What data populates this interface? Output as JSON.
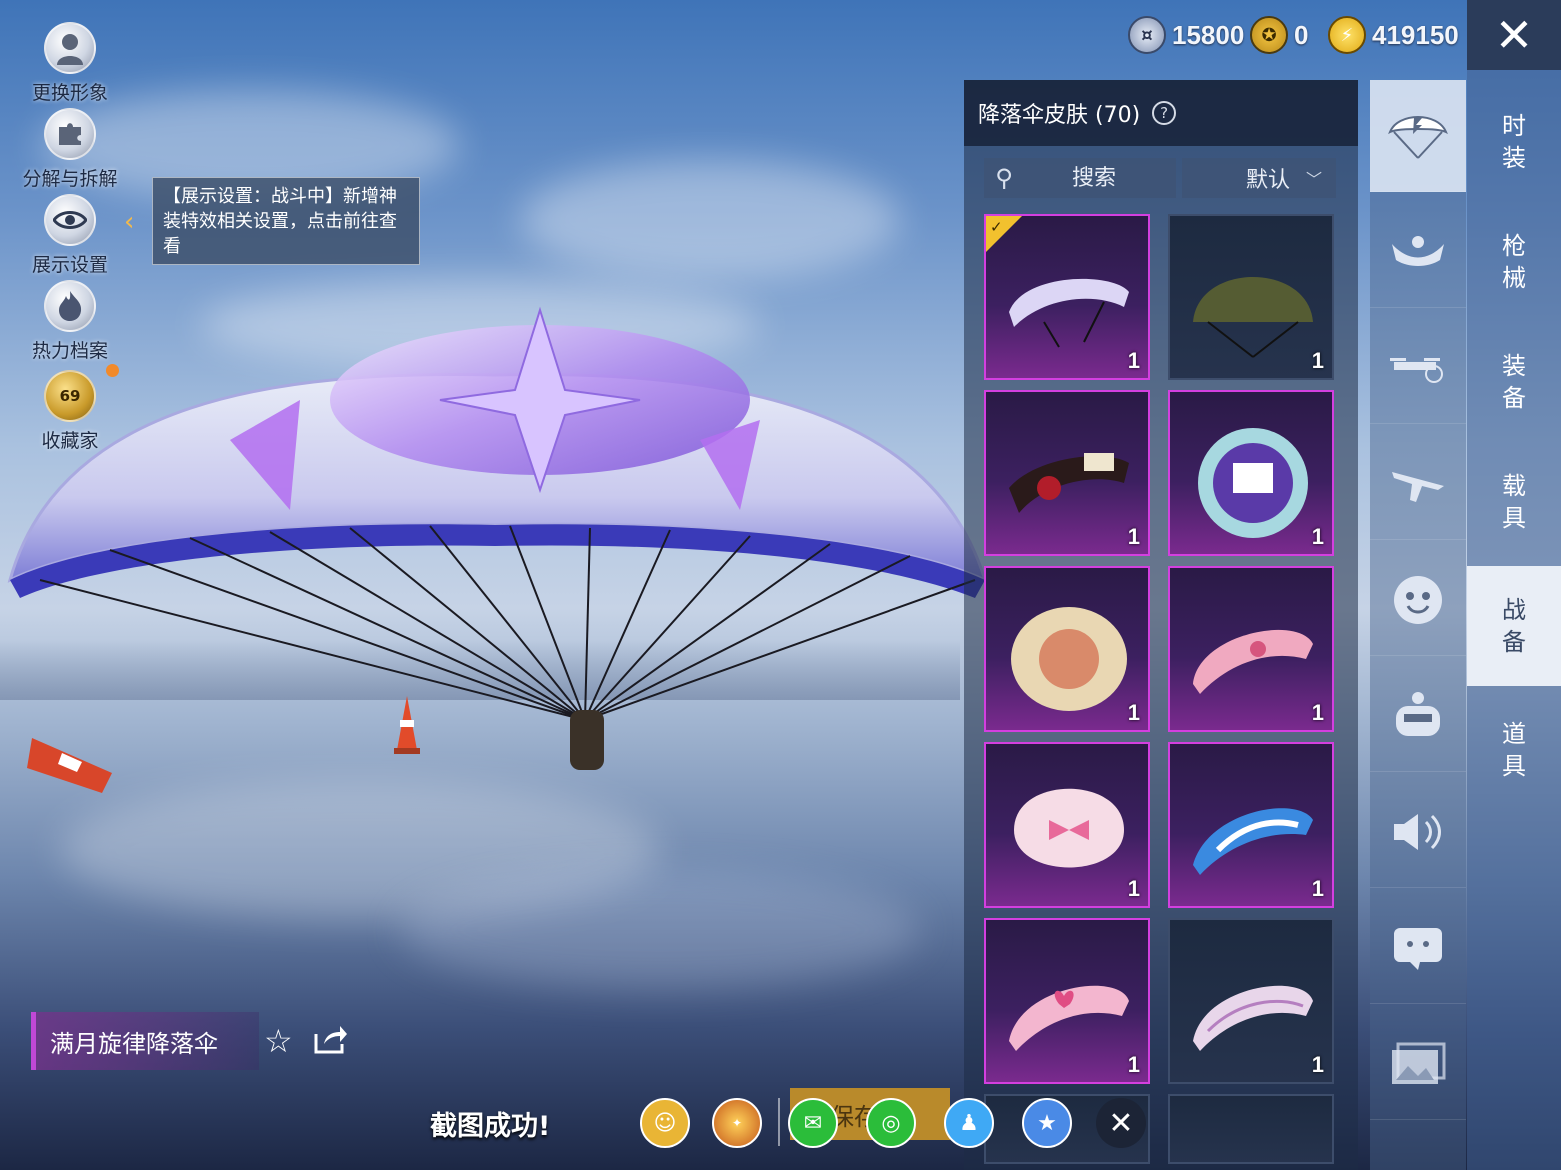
{
  "left_tools": [
    {
      "label": "更换形象",
      "icon": "avatar-icon"
    },
    {
      "label": "分解与拆解",
      "icon": "puzzle-icon"
    },
    {
      "label": "展示设置",
      "icon": "eye-icon"
    },
    {
      "label": "热力档案",
      "icon": "flame-icon"
    },
    {
      "label": "收藏家",
      "icon": "collector-badge-icon",
      "level": "69"
    }
  ],
  "tooltip": {
    "text": "【展示设置：战斗中】新增神装特效相关设置，点击前往查看"
  },
  "currencies": [
    {
      "icon": "coin-icon",
      "value": "15800"
    },
    {
      "icon": "medal-icon",
      "value": "0"
    },
    {
      "icon": "energy-icon",
      "value": "419150"
    }
  ],
  "panel": {
    "title": "降落伞皮肤 (70)",
    "search_placeholder": "搜索",
    "sort_value": "默认",
    "items": [
      {
        "count": "1",
        "equipped": true
      },
      {
        "count": "1"
      },
      {
        "count": "1"
      },
      {
        "count": "1"
      },
      {
        "count": "1"
      },
      {
        "count": "1"
      },
      {
        "count": "1"
      },
      {
        "count": "1"
      },
      {
        "count": "1"
      },
      {
        "count": "1"
      }
    ]
  },
  "main_tabs": [
    "时装",
    "枪械",
    "装备",
    "载具",
    "战备",
    "道具"
  ],
  "active_main_tab": "战备",
  "category_icons": [
    "parachute-icon",
    "skydive-icon",
    "drone-icon",
    "plane-icon",
    "emote-icon",
    "robot-icon",
    "sound-icon",
    "sticker-icon",
    "gallery-icon"
  ],
  "selected_item_name": "满月旋律降落伞",
  "screenshot_message": "截图成功!",
  "save_label": "保存",
  "colors": {
    "rarity_border": "#d43fe0",
    "accent_gold": "#f2c12e"
  }
}
